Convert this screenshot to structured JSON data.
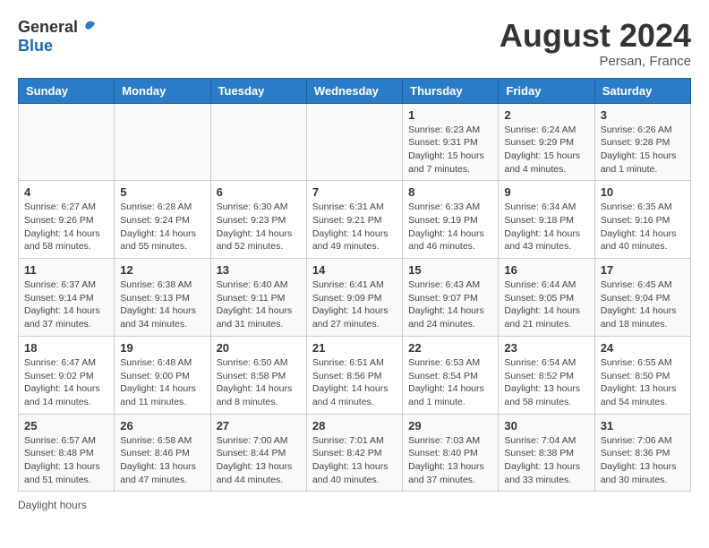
{
  "logo": {
    "general": "General",
    "blue": "Blue"
  },
  "title": {
    "month_year": "August 2024",
    "location": "Persan, France"
  },
  "days_header": [
    "Sunday",
    "Monday",
    "Tuesday",
    "Wednesday",
    "Thursday",
    "Friday",
    "Saturday"
  ],
  "weeks": [
    [
      {
        "day": "",
        "info": ""
      },
      {
        "day": "",
        "info": ""
      },
      {
        "day": "",
        "info": ""
      },
      {
        "day": "",
        "info": ""
      },
      {
        "day": "1",
        "info": "Sunrise: 6:23 AM\nSunset: 9:31 PM\nDaylight: 15 hours and 7 minutes."
      },
      {
        "day": "2",
        "info": "Sunrise: 6:24 AM\nSunset: 9:29 PM\nDaylight: 15 hours and 4 minutes."
      },
      {
        "day": "3",
        "info": "Sunrise: 6:26 AM\nSunset: 9:28 PM\nDaylight: 15 hours and 1 minute."
      }
    ],
    [
      {
        "day": "4",
        "info": "Sunrise: 6:27 AM\nSunset: 9:26 PM\nDaylight: 14 hours and 58 minutes."
      },
      {
        "day": "5",
        "info": "Sunrise: 6:28 AM\nSunset: 9:24 PM\nDaylight: 14 hours and 55 minutes."
      },
      {
        "day": "6",
        "info": "Sunrise: 6:30 AM\nSunset: 9:23 PM\nDaylight: 14 hours and 52 minutes."
      },
      {
        "day": "7",
        "info": "Sunrise: 6:31 AM\nSunset: 9:21 PM\nDaylight: 14 hours and 49 minutes."
      },
      {
        "day": "8",
        "info": "Sunrise: 6:33 AM\nSunset: 9:19 PM\nDaylight: 14 hours and 46 minutes."
      },
      {
        "day": "9",
        "info": "Sunrise: 6:34 AM\nSunset: 9:18 PM\nDaylight: 14 hours and 43 minutes."
      },
      {
        "day": "10",
        "info": "Sunrise: 6:35 AM\nSunset: 9:16 PM\nDaylight: 14 hours and 40 minutes."
      }
    ],
    [
      {
        "day": "11",
        "info": "Sunrise: 6:37 AM\nSunset: 9:14 PM\nDaylight: 14 hours and 37 minutes."
      },
      {
        "day": "12",
        "info": "Sunrise: 6:38 AM\nSunset: 9:13 PM\nDaylight: 14 hours and 34 minutes."
      },
      {
        "day": "13",
        "info": "Sunrise: 6:40 AM\nSunset: 9:11 PM\nDaylight: 14 hours and 31 minutes."
      },
      {
        "day": "14",
        "info": "Sunrise: 6:41 AM\nSunset: 9:09 PM\nDaylight: 14 hours and 27 minutes."
      },
      {
        "day": "15",
        "info": "Sunrise: 6:43 AM\nSunset: 9:07 PM\nDaylight: 14 hours and 24 minutes."
      },
      {
        "day": "16",
        "info": "Sunrise: 6:44 AM\nSunset: 9:05 PM\nDaylight: 14 hours and 21 minutes."
      },
      {
        "day": "17",
        "info": "Sunrise: 6:45 AM\nSunset: 9:04 PM\nDaylight: 14 hours and 18 minutes."
      }
    ],
    [
      {
        "day": "18",
        "info": "Sunrise: 6:47 AM\nSunset: 9:02 PM\nDaylight: 14 hours and 14 minutes."
      },
      {
        "day": "19",
        "info": "Sunrise: 6:48 AM\nSunset: 9:00 PM\nDaylight: 14 hours and 11 minutes."
      },
      {
        "day": "20",
        "info": "Sunrise: 6:50 AM\nSunset: 8:58 PM\nDaylight: 14 hours and 8 minutes."
      },
      {
        "day": "21",
        "info": "Sunrise: 6:51 AM\nSunset: 8:56 PM\nDaylight: 14 hours and 4 minutes."
      },
      {
        "day": "22",
        "info": "Sunrise: 6:53 AM\nSunset: 8:54 PM\nDaylight: 14 hours and 1 minute."
      },
      {
        "day": "23",
        "info": "Sunrise: 6:54 AM\nSunset: 8:52 PM\nDaylight: 13 hours and 58 minutes."
      },
      {
        "day": "24",
        "info": "Sunrise: 6:55 AM\nSunset: 8:50 PM\nDaylight: 13 hours and 54 minutes."
      }
    ],
    [
      {
        "day": "25",
        "info": "Sunrise: 6:57 AM\nSunset: 8:48 PM\nDaylight: 13 hours and 51 minutes."
      },
      {
        "day": "26",
        "info": "Sunrise: 6:58 AM\nSunset: 8:46 PM\nDaylight: 13 hours and 47 minutes."
      },
      {
        "day": "27",
        "info": "Sunrise: 7:00 AM\nSunset: 8:44 PM\nDaylight: 13 hours and 44 minutes."
      },
      {
        "day": "28",
        "info": "Sunrise: 7:01 AM\nSunset: 8:42 PM\nDaylight: 13 hours and 40 minutes."
      },
      {
        "day": "29",
        "info": "Sunrise: 7:03 AM\nSunset: 8:40 PM\nDaylight: 13 hours and 37 minutes."
      },
      {
        "day": "30",
        "info": "Sunrise: 7:04 AM\nSunset: 8:38 PM\nDaylight: 13 hours and 33 minutes."
      },
      {
        "day": "31",
        "info": "Sunrise: 7:06 AM\nSunset: 8:36 PM\nDaylight: 13 hours and 30 minutes."
      }
    ]
  ],
  "footer": {
    "label": "Daylight hours"
  }
}
